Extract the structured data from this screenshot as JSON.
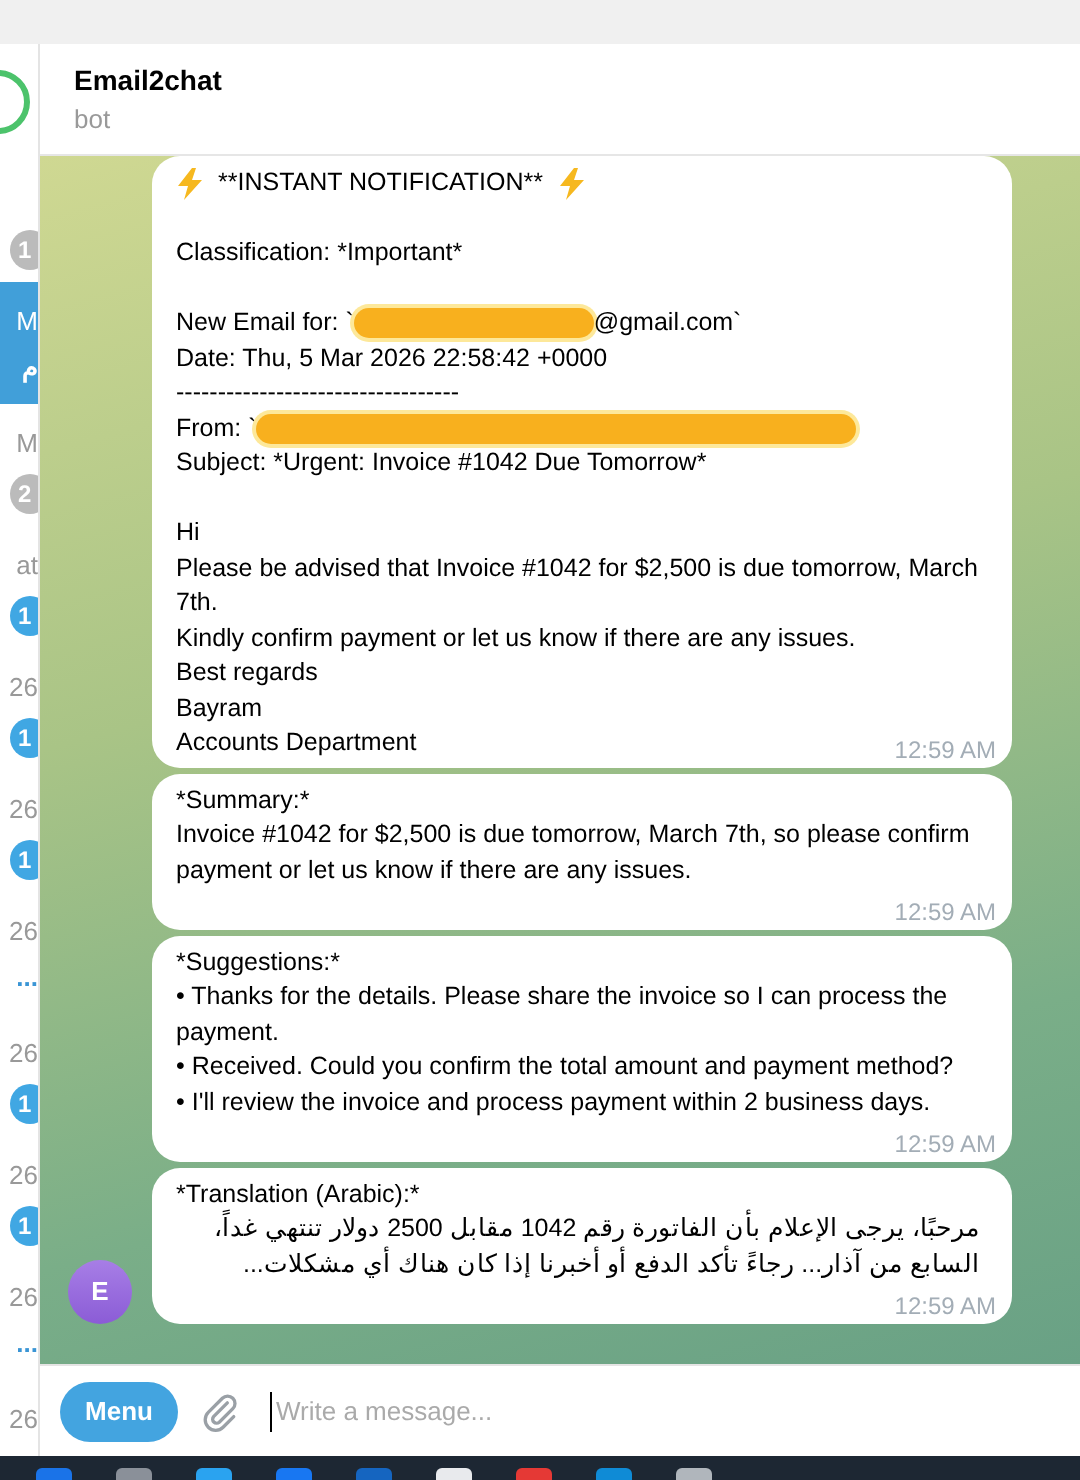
{
  "sidebar": {
    "items": [
      {
        "badge": "1",
        "muted": true,
        "selected": false
      },
      {
        "time": "M",
        "preview": "م",
        "selected": true
      },
      {
        "time": "M",
        "badge": "2",
        "muted": true,
        "selected": false
      },
      {
        "time": "at",
        "badge": "1",
        "muted": false,
        "selected": false
      },
      {
        "time": "26",
        "badge": "1",
        "muted": false,
        "selected": false
      },
      {
        "time": "26",
        "badge": "1",
        "muted": false,
        "selected": false
      },
      {
        "time": "26",
        "preview": "...",
        "selected": false
      },
      {
        "time": "26",
        "badge": "1",
        "muted": false,
        "selected": false
      },
      {
        "time": "26",
        "badge": "1",
        "muted": false,
        "selected": false
      },
      {
        "time": "26",
        "preview": "...",
        "selected": false
      },
      {
        "time": "26",
        "selected": false
      }
    ]
  },
  "chat": {
    "title": "Email2chat",
    "subtitle": "bot"
  },
  "messages": [
    {
      "headline": "**INSTANT NOTIFICATION**",
      "paragraphs": [
        [
          "Classification: *Important*"
        ],
        [
          {
            "kind": "redacted",
            "before": "New Email for: `",
            "after": "@gmail.com`"
          },
          "Date: Thu, 5 Mar 2026 22:58:42 +0000",
          "----------------------------------",
          {
            "kind": "redacted",
            "before": "From: `"
          },
          "Subject: *Urgent: Invoice #1042 Due Tomorrow*"
        ],
        [
          "Hi",
          "Please be advised that Invoice #1042 for $2,500 is due tomorrow, March 7th.",
          "Kindly confirm payment or let us know if there are any issues.",
          "Best regards",
          "Bayram",
          "Accounts Department"
        ]
      ],
      "time": "12:59 AM"
    },
    {
      "paragraphs": [
        [
          "*Summary:*",
          "Invoice #1042 for $2,500 is due tomorrow, March 7th, so please confirm payment or let us know if there are any issues."
        ]
      ],
      "time": "12:59 AM"
    },
    {
      "paragraphs": [
        [
          "*Suggestions:*",
          "• Thanks for the details. Please share the invoice so I can process the payment.",
          "• Received. Could you confirm the total amount and payment method?",
          "• I'll review the invoice and process payment within 2 business days."
        ]
      ],
      "time": "12:59 AM"
    },
    {
      "avatar": "E",
      "paragraphs": [
        [
          "*Translation (Arabic):*",
          {
            "kind": "rtl",
            "text": "مرحبًا، يرجى الإعلام بأن الفاتورة رقم 1042 مقابل 2500 دولار تنتهي غداً، السابع من آذار... رجاءً تأكد الدفع أو أخبرنا إذا كان هناك أي مشكلات..."
          }
        ]
      ],
      "time": "12:59 AM"
    }
  ],
  "composer": {
    "menu_button": "Menu",
    "placeholder": "Write a message..."
  }
}
